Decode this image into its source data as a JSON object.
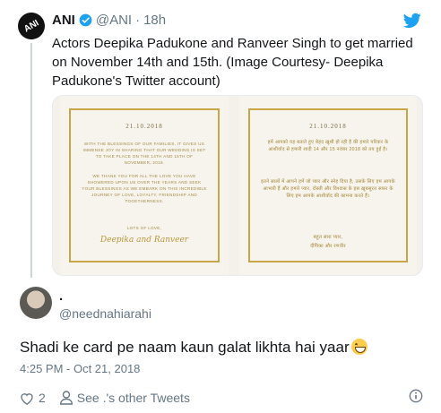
{
  "quoted_tweet": {
    "avatar_text": "ANI",
    "name": "ANI",
    "handle": "@ANI",
    "separator": "·",
    "time": "18h",
    "text": "Actors Deepika Padukone and Ranveer Singh to get married on November 14th and 15th. (Image Courtesy- Deepika Padukone's Twitter account)",
    "image": {
      "left_card": {
        "date": "21.10.2018",
        "body": "WITH THE BLESSINGS OF OUR FAMILIES, IT GIVES US IMMENSE JOY IN SHARING THAT OUR WEDDING IS SET TO TAKE PLACE ON THE 14TH AND 15TH OF NOVEMBER, 2018.",
        "body2": "WE THANK YOU FOR ALL THE LOVE YOU HAVE SHOWERED UPON US OVER THE YEARS AND SEEK YOUR BLESSINGS AS WE EMBARK ON THIS INCREDIBLE JOURNEY OF LOVE, LOYALTY, FRIENDSHIP AND TOGETHERNESS.",
        "signoff": "LOTS OF LOVE,",
        "signature": "Deepika and Ranveer"
      },
      "right_card": {
        "date": "21.10.2018",
        "body": "हमें आपको यह बताते हुए बेहद ख़ुशी हो रही है की हमारे परिवार के आशीर्वाद से हमारी शादी 14 और 15 नवंबर 2018 को तय हुई है।",
        "body2": "इतने सालों में आपने हमें जो प्यार और स्नेह दिया है, उसके लिए हम आपके आभारी हैं और हमारे प्यार, दोस्ती और विश्वास के इस ख़ूबसूरत सफ़र के लिए हम आपके आशीर्वाद की कामना करते हैं।",
        "signoff": "बहुत सारा प्यार,",
        "signature": "दीपिका और रणवीर"
      }
    }
  },
  "reply": {
    "name": ".",
    "handle": "@neednahiarahi",
    "text": "Shadi ke card pe naam kaun galat likhta hai yaar",
    "timestamp": "4:25 PM - Oct 21, 2018",
    "likes_count": "2",
    "other_tweets_label": "See .'s other Tweets"
  },
  "colors": {
    "verified": "#1da1f2",
    "twitter_bird": "#1da1f2",
    "muted": "#657786",
    "gold": "#c9a646"
  },
  "icons": [
    "verified-badge-icon",
    "twitter-bird-icon",
    "heart-icon",
    "person-icon",
    "info-icon",
    "grinning-face-emoji"
  ]
}
